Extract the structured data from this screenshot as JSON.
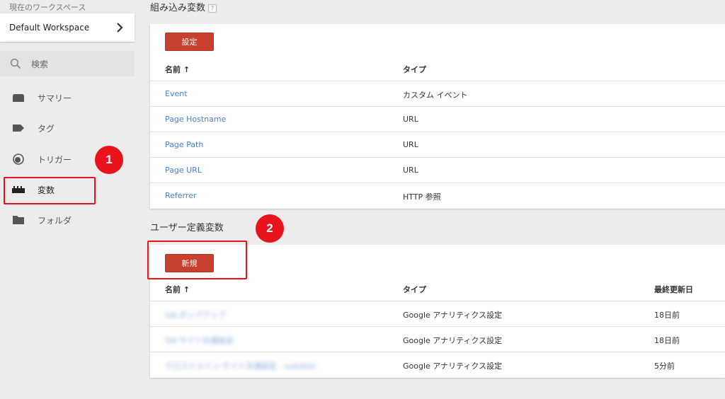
{
  "sidebar": {
    "workspace_label": "現在のワークスペース",
    "workspace_name": "Default Workspace",
    "search_label": "検索",
    "items": [
      {
        "label": "サマリー",
        "icon": "folder-open-icon"
      },
      {
        "label": "タグ",
        "icon": "tag-icon"
      },
      {
        "label": "トリガー",
        "icon": "trigger-icon"
      },
      {
        "label": "変数",
        "icon": "variables-icon"
      },
      {
        "label": "フォルダ",
        "icon": "folder-icon"
      }
    ],
    "active_item": "変数"
  },
  "annotations": {
    "badge1": "1",
    "badge2": "2",
    "highlight_color": "#e8131c"
  },
  "builtin": {
    "title": "組み込み変数",
    "help": "?",
    "button": "設定",
    "headers": {
      "name": "名前 ↑",
      "type": "タイプ"
    },
    "rows": [
      {
        "name": "Event",
        "type": "カスタム イベント"
      },
      {
        "name": "Page Hostname",
        "type": "URL"
      },
      {
        "name": "Page Path",
        "type": "URL"
      },
      {
        "name": "Page URL",
        "type": "URL"
      },
      {
        "name": "Referrer",
        "type": "HTTP 参照"
      }
    ]
  },
  "user": {
    "title": "ユーザー定義変数",
    "button": "新規",
    "headers": {
      "name": "名前 ↑",
      "type": "タイプ",
      "updated": "最終更新日"
    },
    "rows": [
      {
        "name": "GA-ポップアップ",
        "type": "Google アナリティクス設定",
        "updated": "18日前"
      },
      {
        "name": "GA-サイト共通設定",
        "type": "Google アナリティクス設定",
        "updated": "18日前"
      },
      {
        "name": "クロスドメイン-サイト共通設定 - subdom",
        "type": "Google アナリティクス設定",
        "updated": "5分前"
      }
    ]
  },
  "colors": {
    "accent_button": "#c8412e",
    "link": "#4a7fc9"
  }
}
